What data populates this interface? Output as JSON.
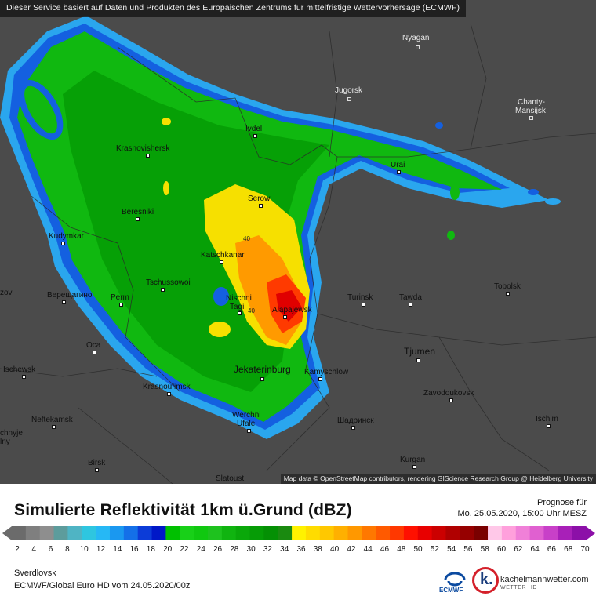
{
  "banner": "Dieser Service basiert auf Daten und Produkten des Europäischen Zentrums für mittelfristige Wettervorhersage (ECMWF)",
  "map": {
    "cities": [
      {
        "name": "Nyagan"
      },
      {
        "name": "Jugorsk"
      },
      {
        "name": "Chanty-"
      },
      {
        "name": "Mansijsk"
      },
      {
        "name": "Ivdel"
      },
      {
        "name": "Krasnovishersk"
      },
      {
        "name": "Urai"
      },
      {
        "name": "Serow"
      },
      {
        "name": "Beresniki"
      },
      {
        "name": "Kudymkar"
      },
      {
        "name": "Katschkanar"
      },
      {
        "name": "Tschussowoi"
      },
      {
        "name": "Tobolsk"
      },
      {
        "name": "Perm"
      },
      {
        "name": "Nischni"
      },
      {
        "name": "Tagil"
      },
      {
        "name": "Turinsk"
      },
      {
        "name": "Tawda"
      },
      {
        "name": "Alapajewsk"
      },
      {
        "name": "Верещагино"
      },
      {
        "name": "zov"
      },
      {
        "name": "Oca"
      },
      {
        "name": "Tjumen"
      },
      {
        "name": "Ischewsk"
      },
      {
        "name": "Jekaterinburg"
      },
      {
        "name": "Kamyschlow"
      },
      {
        "name": "Krasnoufimsk"
      },
      {
        "name": "Zavodoukovsk"
      },
      {
        "name": "Neftekamsk"
      },
      {
        "name": "Werchni"
      },
      {
        "name": "Ufalei"
      },
      {
        "name": "Шадринск"
      },
      {
        "name": "Ischim"
      },
      {
        "name": "chnyje"
      },
      {
        "name": "lny"
      },
      {
        "name": "Birsk"
      },
      {
        "name": "Kurgan"
      },
      {
        "name": "Slatoust"
      }
    ],
    "value_labels": [
      "40",
      "40"
    ],
    "attribution": "Map data © OpenStreetMap contributors, rendering GIScience Research Group @ Heidelberg University"
  },
  "legend": {
    "title": "Simulierte Reflektivität 1km ü.Grund (dBZ)",
    "forecast_label": "Prognose für",
    "forecast_date": "Mo. 25.05.2020, 15:00 Uhr MESZ",
    "ticks": [
      "2",
      "4",
      "6",
      "8",
      "10",
      "12",
      "14",
      "16",
      "18",
      "20",
      "22",
      "24",
      "26",
      "28",
      "30",
      "32",
      "34",
      "36",
      "38",
      "40",
      "42",
      "44",
      "46",
      "48",
      "50",
      "52",
      "54",
      "56",
      "58",
      "60",
      "62",
      "64",
      "66",
      "68",
      "70"
    ],
    "colors": [
      "#6b6b6b",
      "#7f7f7f",
      "#8e8e8e",
      "#5d9c9c",
      "#4fb4c4",
      "#2ec6e0",
      "#26b8f5",
      "#1a98f0",
      "#1470e8",
      "#0c3cd8",
      "#0018c8",
      "#00c000",
      "#18d018",
      "#10c810",
      "#1ec21e",
      "#10b410",
      "#0aa80a",
      "#069c06",
      "#049004",
      "#1a8a10",
      "#fff200",
      "#ffdc00",
      "#ffc800",
      "#ffb000",
      "#ff9800",
      "#ff7800",
      "#ff5a00",
      "#ff3800",
      "#ff1000",
      "#e80000",
      "#cc0000",
      "#b00000",
      "#960000",
      "#7a0000",
      "#ffc8e8",
      "#ffa0dc",
      "#f080d8",
      "#e060d0",
      "#c840c8",
      "#a820b8",
      "#8c10a8"
    ],
    "region": "Sverdlovsk",
    "model": "ECMWF/Global Euro HD vom  24.05.2020/00z",
    "ecmwf": "ECMWF",
    "brand": "kachelmannwetter.com",
    "brand_sub": "WETTER HD",
    "brand_mark": "k."
  }
}
